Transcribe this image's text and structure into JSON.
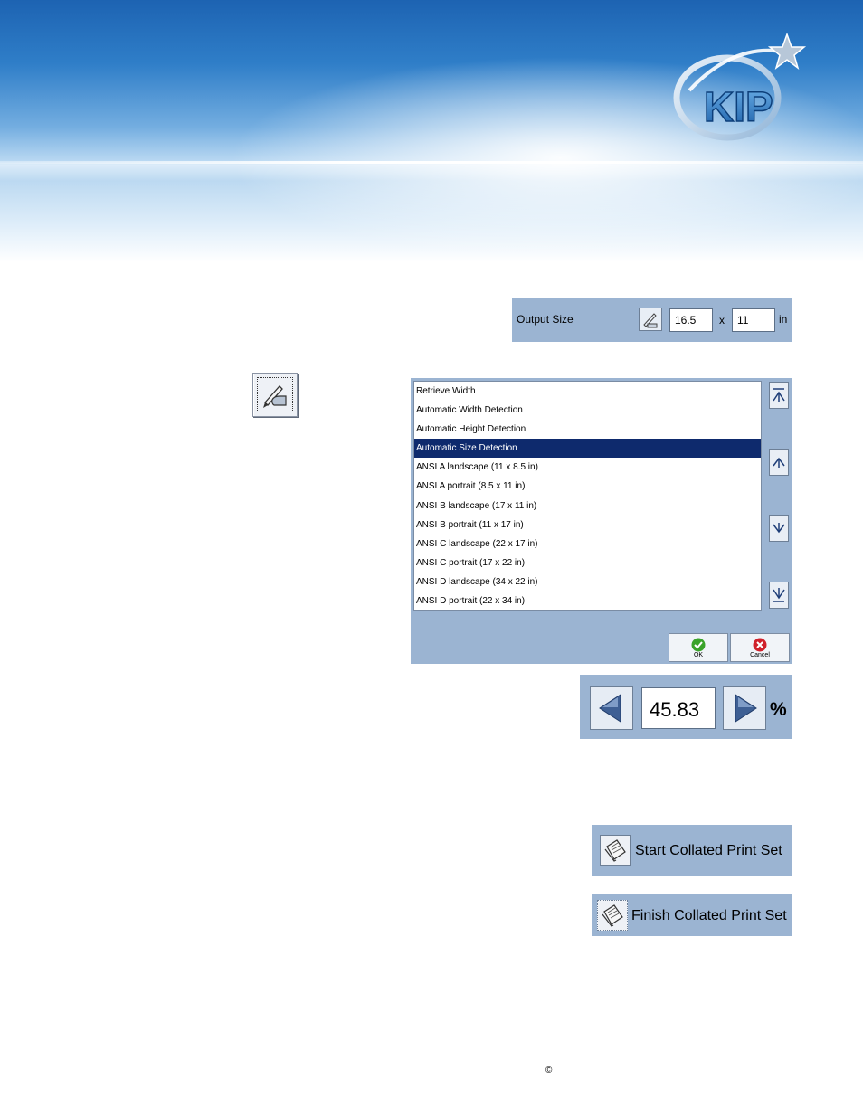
{
  "logo": {
    "text": "KIP"
  },
  "output_size": {
    "label": "Output Size",
    "width": "16.5",
    "times": "x",
    "height": "11",
    "unit": "in"
  },
  "size_list": {
    "items": [
      "Retrieve Width",
      "Automatic Width Detection",
      "Automatic Height Detection",
      "Automatic Size Detection",
      "ANSI A landscape (11 x 8.5 in)",
      "ANSI A portrait (8.5 x 11 in)",
      "ANSI B landscape (17 x 11 in)",
      "ANSI B portrait (11 x 17 in)",
      "ANSI C landscape (22 x 17 in)",
      "ANSI C portrait (17 x 22 in)",
      "ANSI D landscape (34 x 22 in)",
      "ANSI D portrait (22 x 34 in)"
    ],
    "selected_index": 3,
    "ok_label": "OK",
    "cancel_label": "Cancel"
  },
  "scale": {
    "value": "45.83",
    "unit": "%"
  },
  "collate": {
    "start_label": "Start Collated Print Set",
    "finish_label": "Finish Collated Print Set"
  },
  "footer": {
    "copyright": "©"
  },
  "colors": {
    "panel": "#9bb4d2",
    "selection": "#0e2a6d",
    "ok_green": "#3aa32a",
    "cancel_red": "#d0212b"
  }
}
